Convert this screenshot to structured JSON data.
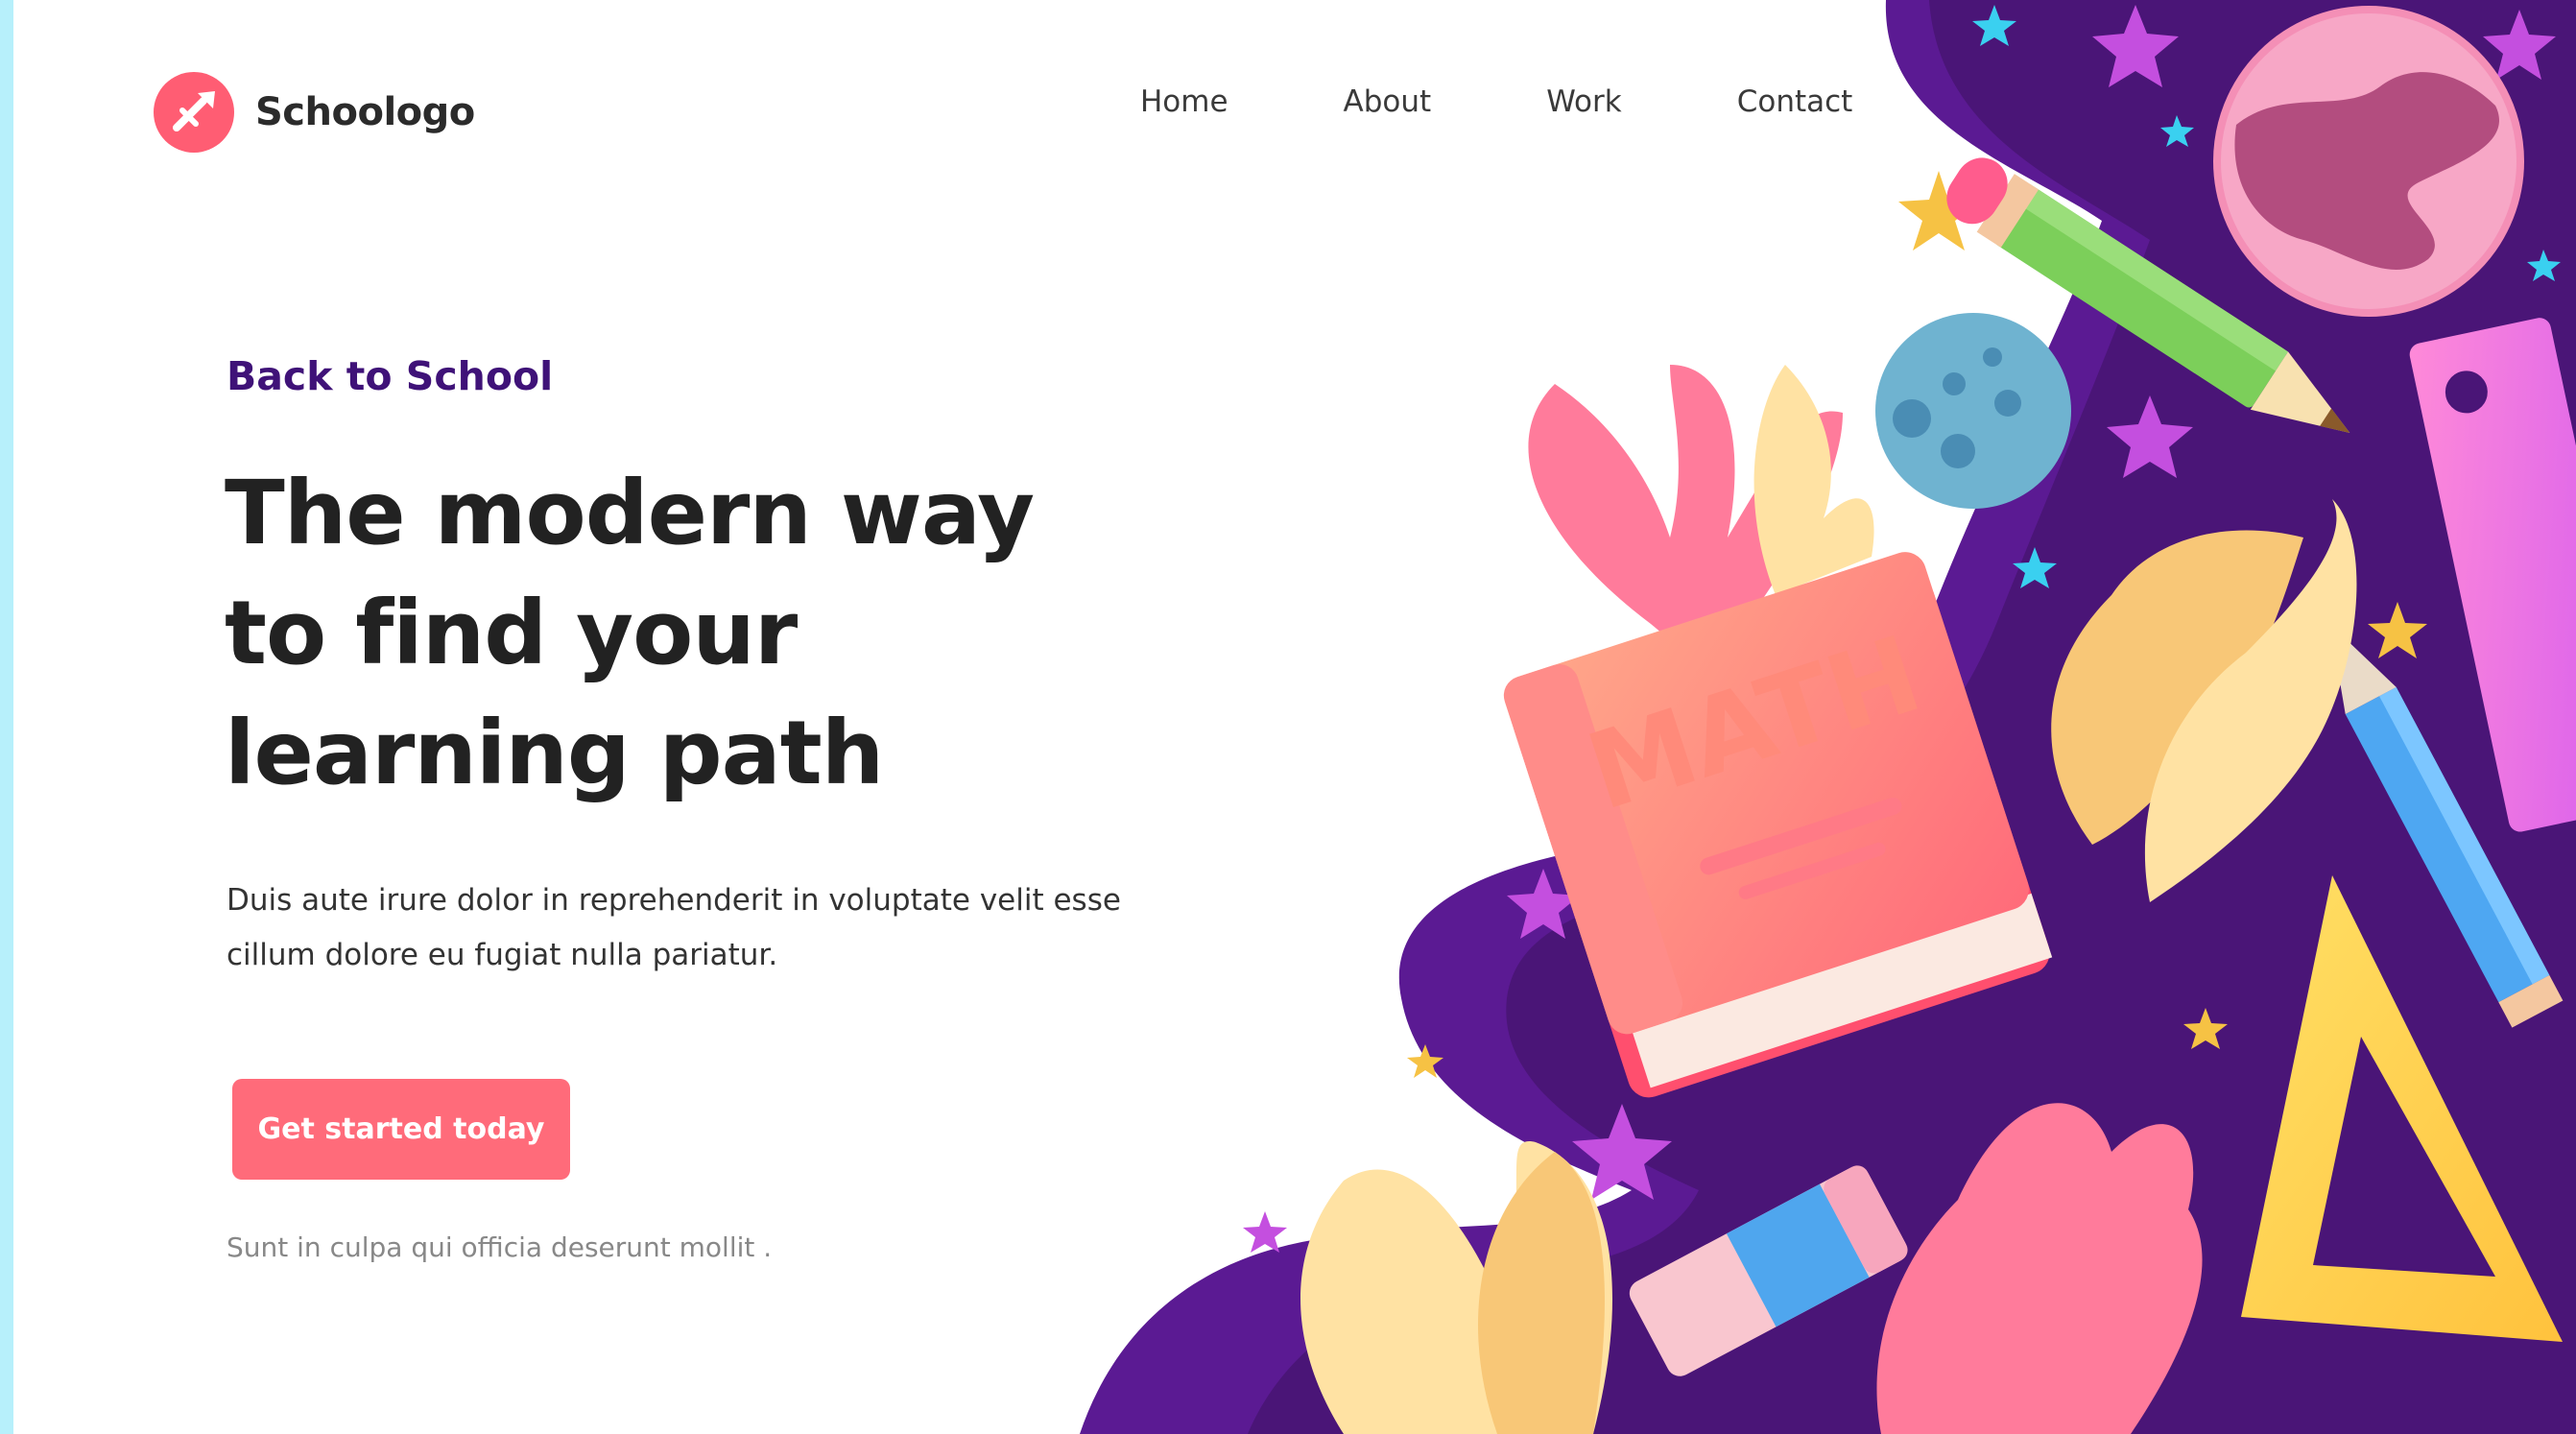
{
  "brand": {
    "name": "Schoologo"
  },
  "nav": {
    "items": [
      {
        "label": "Home"
      },
      {
        "label": "About"
      },
      {
        "label": "Work"
      },
      {
        "label": "Contact"
      }
    ]
  },
  "hero": {
    "eyebrow": "Back to School",
    "headline": [
      "The modern way",
      "to find your",
      "learning path"
    ],
    "body_line1": "Duis aute irure dolor in reprehenderit in voluptate velit esse",
    "body_line2": "cillum dolore eu fugiat nulla pariatur.",
    "cta_label": "Get started today",
    "footnote": "Sunt in culpa qui officia deserunt mollit ."
  },
  "illustration": {
    "book_title": "MATH",
    "colors": {
      "background_purple": "#4a1577",
      "accent_coral": "#ff6b7a",
      "eyebrow_purple": "#3f1278"
    },
    "icons": [
      "planet-icon",
      "moon-icon",
      "pencil-icon",
      "ruler-icon",
      "triangle-ruler-icon",
      "eraser-icon",
      "book-icon",
      "leaf-icon",
      "star-icon"
    ]
  }
}
